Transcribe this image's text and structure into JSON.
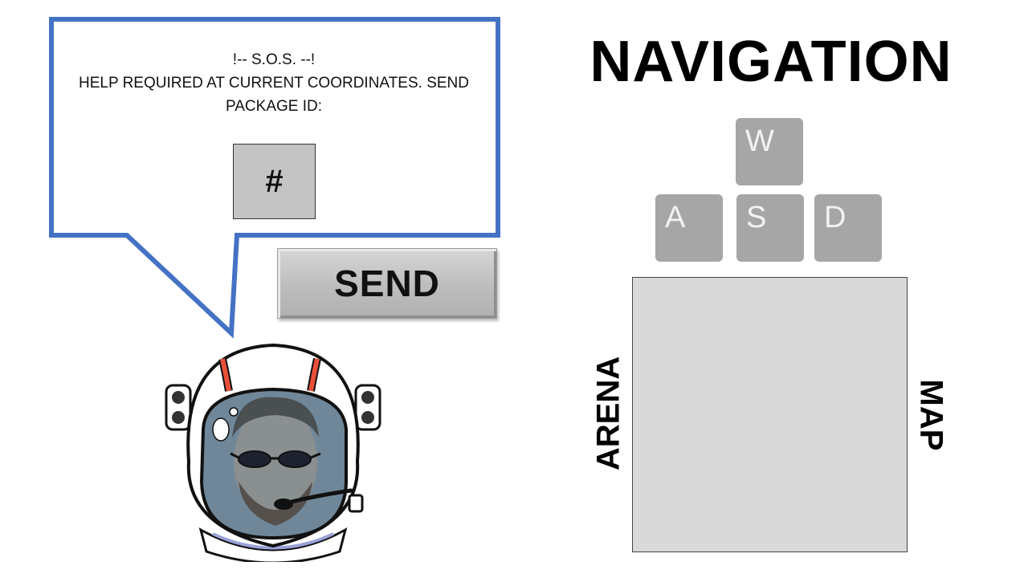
{
  "message": {
    "line1": "!-- S.O.S. --!",
    "line2": "HELP REQUIRED AT CURRENT COORDINATES. SEND",
    "line3": "PACKAGE ID:",
    "package_id_placeholder": "#"
  },
  "send_label": "SEND",
  "navigation": {
    "title": "NAVIGATION",
    "keys": {
      "w": "W",
      "a": "A",
      "s": "S",
      "d": "D"
    },
    "arena_label": "ARENA",
    "map_label": "MAP"
  },
  "colors": {
    "bubble_border": "#4472c4",
    "key_fill": "#a6a6a6",
    "arena_fill": "#d9d9d9",
    "helmet_stripe": "#e8503a"
  }
}
